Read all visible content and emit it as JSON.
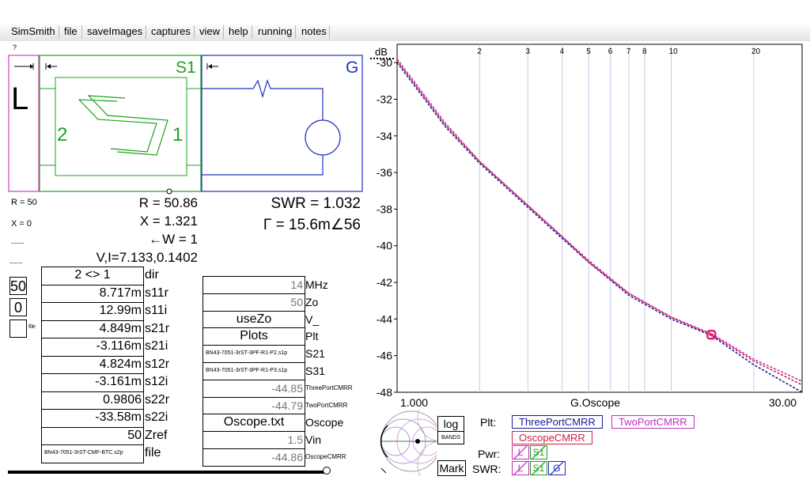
{
  "menu": {
    "items": [
      "SimSmith",
      "file",
      "saveImages",
      "captures",
      "view",
      "help",
      "running",
      "notes"
    ]
  },
  "question_mark": "?",
  "circuit": {
    "load_label": "L",
    "s1_label": "S1",
    "s1_port_left": "2",
    "s1_port_right": "1",
    "g_label": "G",
    "colors": {
      "load": "#d040c0",
      "s1": "#20a020",
      "g": "#2030c0"
    }
  },
  "side_labels": {
    "r": "R = 50",
    "x": "X = 0",
    "tiny1": "~~~~",
    "tiny2": "~~~~",
    "spin1_value": "50",
    "spin2_value": "0",
    "file_small": "file"
  },
  "readouts": {
    "r": "R = 50.86",
    "x": "X = 1.321",
    "w": "←W = 1",
    "vi": "V,I=7.133,0.1402",
    "swr": "SWR = 1.032",
    "gamma": "Γ = 15.6m∠56"
  },
  "s_params": [
    {
      "value": "2 <> 1",
      "label": "dir"
    },
    {
      "value": "8.717m",
      "label": "s11r"
    },
    {
      "value": "12.99m",
      "label": "s11i"
    },
    {
      "value": "4.849m",
      "label": "s21r"
    },
    {
      "value": "-3.116m",
      "label": "s21i"
    },
    {
      "value": "4.824m",
      "label": "s12r"
    },
    {
      "value": "-3.161m",
      "label": "s12i"
    },
    {
      "value": "0.9806",
      "label": "s22r"
    },
    {
      "value": "-33.58m",
      "label": "s22i"
    },
    {
      "value": "50",
      "label": "Zref"
    },
    {
      "value": "BN43-7051-3rST-CMF-BTC.s2p",
      "label": "file"
    }
  ],
  "oscope_params": [
    {
      "value": "14",
      "label": "MHz"
    },
    {
      "value": "50",
      "label": "Zo"
    },
    {
      "value": "useZo",
      "label": "V_"
    },
    {
      "value": "Plots",
      "label": "Plt"
    },
    {
      "value": "BN43-7051-3rST-3PF-R1-P2.s1p",
      "label": "S21"
    },
    {
      "value": "BN43-7051-3rST-3PF-R1-P3.s1p",
      "label": "S31"
    },
    {
      "value": "-44.85",
      "label": "ThreePortCMRR"
    },
    {
      "value": "-44.79",
      "label": "TwoPortCMRR"
    },
    {
      "value": "Oscope.txt",
      "label": "Oscope"
    },
    {
      "value": "1.5",
      "label": "Vin"
    },
    {
      "value": "-44.86",
      "label": "OscopeCMRR"
    }
  ],
  "bottom_controls": {
    "log_label": "log",
    "bands_label": "BANDS",
    "mark_label": "Mark",
    "plt_label": "Plt:",
    "pwr_label": "Pwr:",
    "swr_label": "SWR:",
    "plot_buttons": [
      {
        "label": "ThreePortCMRR",
        "color": "#1a1aa0"
      },
      {
        "label": "TwoPortCMRR",
        "color": "#c030c0"
      },
      {
        "label": "OscopeCMRR",
        "color": "#d02040"
      }
    ],
    "pwr_buttons": [
      {
        "label": "L",
        "color": "#c030c0"
      },
      {
        "label": "S1",
        "color": "#20a020"
      }
    ],
    "swr_buttons": [
      {
        "label": "L",
        "color": "#c030c0"
      },
      {
        "label": "S1",
        "color": "#20a020"
      },
      {
        "label": "G",
        "color": "#2030c0"
      }
    ]
  },
  "chart_data": {
    "type": "line",
    "title": "",
    "ylabel": "dB",
    "xlabel": "G.Oscope",
    "x_scale": "log",
    "xlim": [
      1.0,
      30.0
    ],
    "ylim": [
      -48,
      -29
    ],
    "x_end_labels": [
      "1.000",
      "30.00"
    ],
    "x_top_ticks": [
      2,
      3,
      4,
      5,
      6,
      7,
      8,
      10,
      20
    ],
    "y_ticks": [
      -30,
      -32,
      -34,
      -36,
      -38,
      -40,
      -42,
      -44,
      -46,
      -48
    ],
    "grid": true,
    "marker": {
      "x": 14,
      "y": -44.86,
      "color": "#e0207a"
    },
    "series": [
      {
        "name": "ThreePortCMRR",
        "color": "#1a1aa0",
        "x": [
          1.0,
          1.5,
          2.0,
          3.0,
          4.0,
          5.0,
          7.0,
          10.0,
          14.0,
          20.0,
          30.0
        ],
        "y": [
          -30.0,
          -33.5,
          -35.5,
          -37.9,
          -39.6,
          -40.9,
          -42.7,
          -44.0,
          -44.9,
          -46.5,
          -48.0
        ]
      },
      {
        "name": "TwoPortCMRR",
        "color": "#c030c0",
        "x": [
          1.0,
          1.5,
          2.0,
          3.0,
          4.0,
          5.0,
          7.0,
          10.0,
          14.0,
          20.0,
          30.0
        ],
        "y": [
          -29.8,
          -33.3,
          -35.4,
          -37.8,
          -39.5,
          -40.8,
          -42.6,
          -43.9,
          -44.8,
          -46.2,
          -47.4
        ]
      },
      {
        "name": "OscopeCMRR",
        "color": "#d02040",
        "x": [
          1.0,
          1.5,
          2.0,
          3.0,
          4.0,
          5.0,
          7.0,
          10.0,
          14.0,
          20.0,
          30.0
        ],
        "y": [
          -29.9,
          -33.4,
          -35.4,
          -37.8,
          -39.5,
          -40.9,
          -42.6,
          -43.9,
          -44.85,
          -46.3,
          -47.6
        ]
      }
    ]
  }
}
